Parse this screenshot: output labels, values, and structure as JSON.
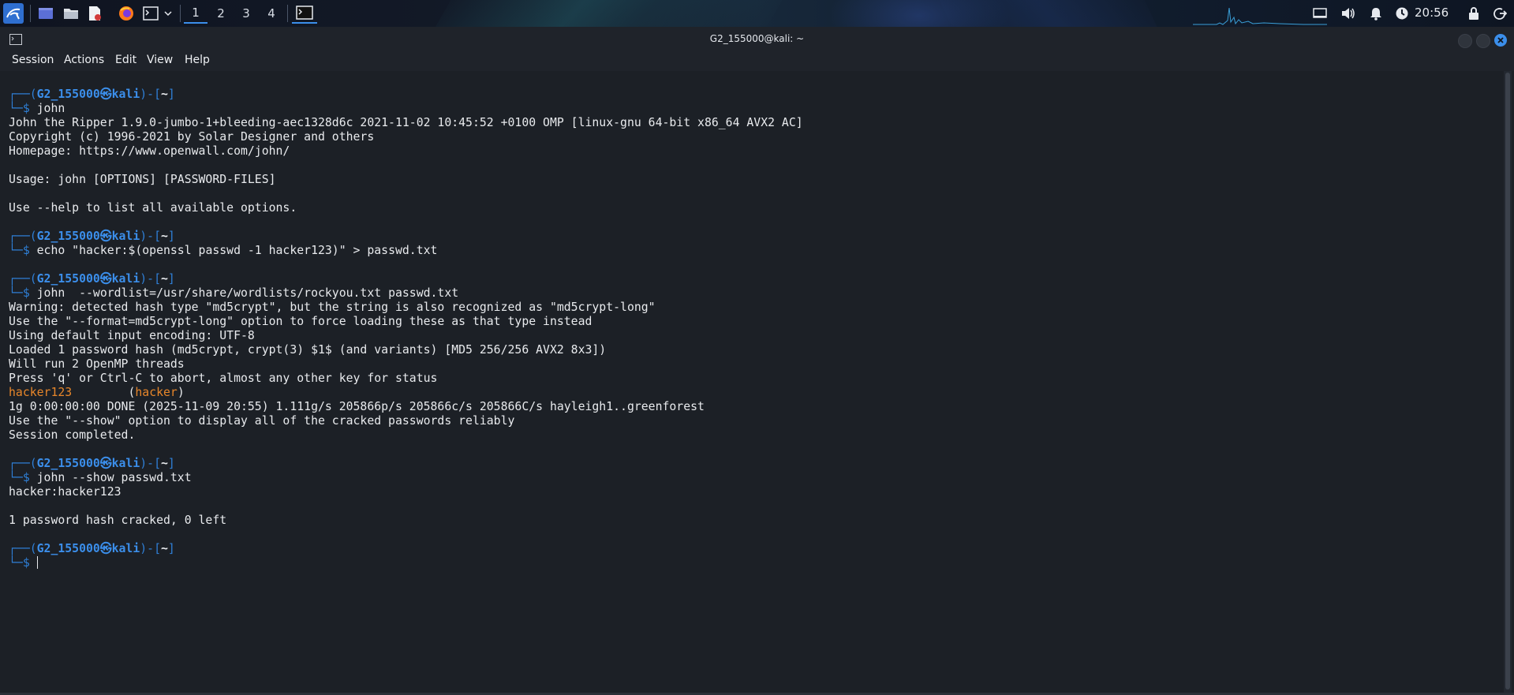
{
  "panel": {
    "workspaces": [
      "1",
      "2",
      "3",
      "4"
    ],
    "active_workspace": "1",
    "clock": "20:56"
  },
  "window": {
    "title": "G2_155000@kali: ~",
    "menu": [
      "Session",
      "Actions",
      "Edit",
      "View",
      "Help"
    ]
  },
  "prompt": {
    "user": "G2_155000",
    "host": "kali",
    "dir": "~"
  },
  "terminal": {
    "lines": [
      {
        "type": "prompt"
      },
      {
        "type": "cmd",
        "text": "john"
      },
      {
        "type": "out",
        "text": "John the Ripper 1.9.0-jumbo-1+bleeding-aec1328d6c 2021-11-02 10:45:52 +0100 OMP [linux-gnu 64-bit x86_64 AVX2 AC]"
      },
      {
        "type": "out",
        "text": "Copyright (c) 1996-2021 by Solar Designer and others"
      },
      {
        "type": "out",
        "text": "Homepage: https://www.openwall.com/john/"
      },
      {
        "type": "out",
        "text": ""
      },
      {
        "type": "out",
        "text": "Usage: john [OPTIONS] [PASSWORD-FILES]"
      },
      {
        "type": "out",
        "text": ""
      },
      {
        "type": "out",
        "text": "Use --help to list all available options."
      },
      {
        "type": "out",
        "text": ""
      },
      {
        "type": "prompt"
      },
      {
        "type": "cmd",
        "text": "echo \"hacker:$(openssl passwd -1 hacker123)\" > passwd.txt"
      },
      {
        "type": "out",
        "text": ""
      },
      {
        "type": "prompt"
      },
      {
        "type": "cmd",
        "text": "john  --wordlist=/usr/share/wordlists/rockyou.txt passwd.txt"
      },
      {
        "type": "out",
        "text": "Warning: detected hash type \"md5crypt\", but the string is also recognized as \"md5crypt-long\""
      },
      {
        "type": "out",
        "text": "Use the \"--format=md5crypt-long\" option to force loading these as that type instead"
      },
      {
        "type": "out",
        "text": "Using default input encoding: UTF-8"
      },
      {
        "type": "out",
        "text": "Loaded 1 password hash (md5crypt, crypt(3) $1$ (and variants) [MD5 256/256 AVX2 8x3])"
      },
      {
        "type": "out",
        "text": "Will run 2 OpenMP threads"
      },
      {
        "type": "out",
        "text": "Press 'q' or Ctrl-C to abort, almost any other key for status"
      },
      {
        "type": "cracked",
        "password": "hacker123",
        "gap": "        (",
        "user": "hacker",
        "close": ")"
      },
      {
        "type": "out",
        "text": "1g 0:00:00:00 DONE (2025-11-09 20:55) 1.111g/s 205866p/s 205866c/s 205866C/s hayleigh1..greenforest"
      },
      {
        "type": "out",
        "text": "Use the \"--show\" option to display all of the cracked passwords reliably"
      },
      {
        "type": "out",
        "text": "Session completed."
      },
      {
        "type": "out",
        "text": ""
      },
      {
        "type": "prompt"
      },
      {
        "type": "cmd",
        "text": "john --show passwd.txt"
      },
      {
        "type": "out",
        "text": "hacker:hacker123"
      },
      {
        "type": "out",
        "text": ""
      },
      {
        "type": "out",
        "text": "1 password hash cracked, 0 left"
      },
      {
        "type": "out",
        "text": ""
      },
      {
        "type": "prompt"
      },
      {
        "type": "cmd",
        "text": ""
      }
    ]
  },
  "colors": {
    "prompt_frame": "#2f7fd6",
    "prompt_user": "#3b8eea",
    "cracked": "#e7862a",
    "text": "#e8eaed",
    "background": "#1c2026"
  }
}
